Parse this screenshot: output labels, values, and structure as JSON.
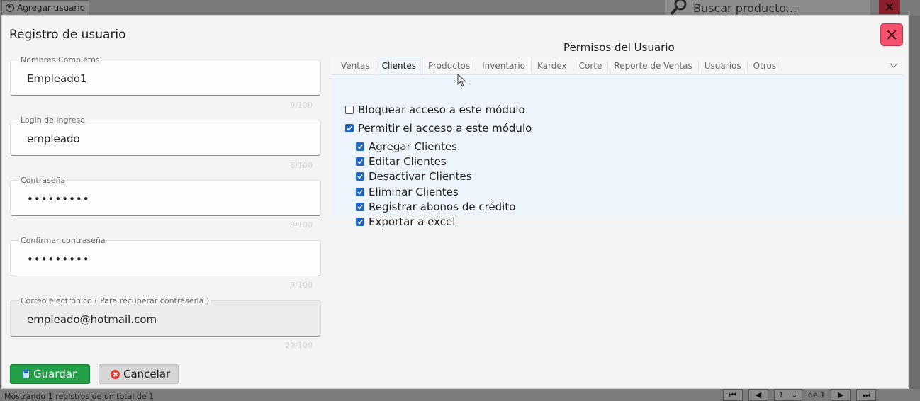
{
  "background": {
    "add_user_label": "Agregar usuario",
    "search_placeholder": "Buscar producto...",
    "status_text": "Mostrando 1 registros de un total de 1",
    "pager": {
      "page": "1",
      "of_label": "de 1"
    }
  },
  "modal": {
    "title": "Registro de usuario",
    "fields": [
      {
        "label": "Nombres Completos",
        "value": "Empleado1",
        "counter": "9/100"
      },
      {
        "label": "Login de ingreso",
        "value": "empleado",
        "counter": "8/100"
      },
      {
        "label": "Contraseña",
        "value": "•••••••••",
        "counter": "9/100"
      },
      {
        "label": "Confirmar contraseña",
        "value": "•••••••••",
        "counter": "9/100"
      },
      {
        "label": "Correo electrónico ( Para recuperar contraseña )",
        "value": "empleado@hotmail.com",
        "counter": "20/100"
      }
    ],
    "buttons": {
      "save": "Guardar",
      "cancel": "Cancelar"
    }
  },
  "permissions": {
    "title": "Permisos del Usuario",
    "tabs": [
      "Ventas",
      "Clientes",
      "Productos",
      "Inventario",
      "Kardex",
      "Corte",
      "Reporte de Ventas",
      "Usuarios",
      "Otros"
    ],
    "active_tab": "Clientes",
    "block_access": {
      "label": "Bloquear acceso a este módulo",
      "checked": false
    },
    "allow_access": {
      "label": "Permitir el acceso a este módulo",
      "checked": true
    },
    "options": [
      {
        "label": "Agregar Clientes",
        "checked": true
      },
      {
        "label": "Editar Clientes",
        "checked": true
      },
      {
        "label": "Desactivar Clientes",
        "checked": true
      },
      {
        "label": "Eliminar Clientes",
        "checked": true
      },
      {
        "label": "Registrar abonos de crédito",
        "checked": true
      },
      {
        "label": "Exportar a excel",
        "checked": true
      }
    ]
  },
  "colors": {
    "save": "#24a148",
    "close": "#f4516c",
    "check": "#1f66c1"
  }
}
